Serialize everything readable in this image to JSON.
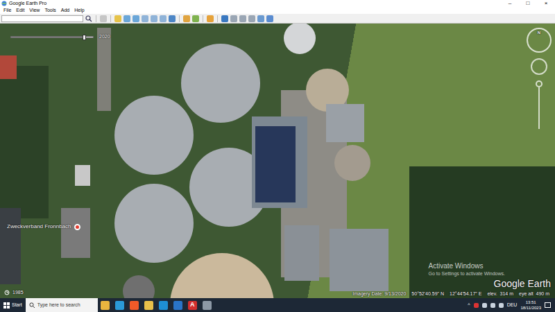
{
  "window": {
    "title": "Google Earth Pro",
    "controls": [
      "–",
      "□",
      "×"
    ]
  },
  "menu": [
    "File",
    "Edit",
    "View",
    "Tools",
    "Add",
    "Help"
  ],
  "time_slider": {
    "label": "2020",
    "level": 0.9
  },
  "placemark": {
    "label": "Zweckverband Fronnbach"
  },
  "historical": {
    "label": "1985"
  },
  "compass": {
    "label": "N"
  },
  "status": {
    "imagery_date": "Imagery Date: 9/13/2020",
    "lat": "50°52'40.59\" N",
    "lon": "12°44'54.17\" E",
    "elev": "elev.  314 m",
    "eye_alt": "eye alt  490 m"
  },
  "watermark": {
    "title": "Activate Windows",
    "subtitle": "Go to Settings to activate Windows."
  },
  "logo": "Google Earth",
  "taskbar": {
    "start": "Start",
    "search": "Type here to search",
    "adobe_label": "A",
    "caret": "^",
    "language": "DEU",
    "time": "13:51",
    "date": "18/11/2023"
  }
}
